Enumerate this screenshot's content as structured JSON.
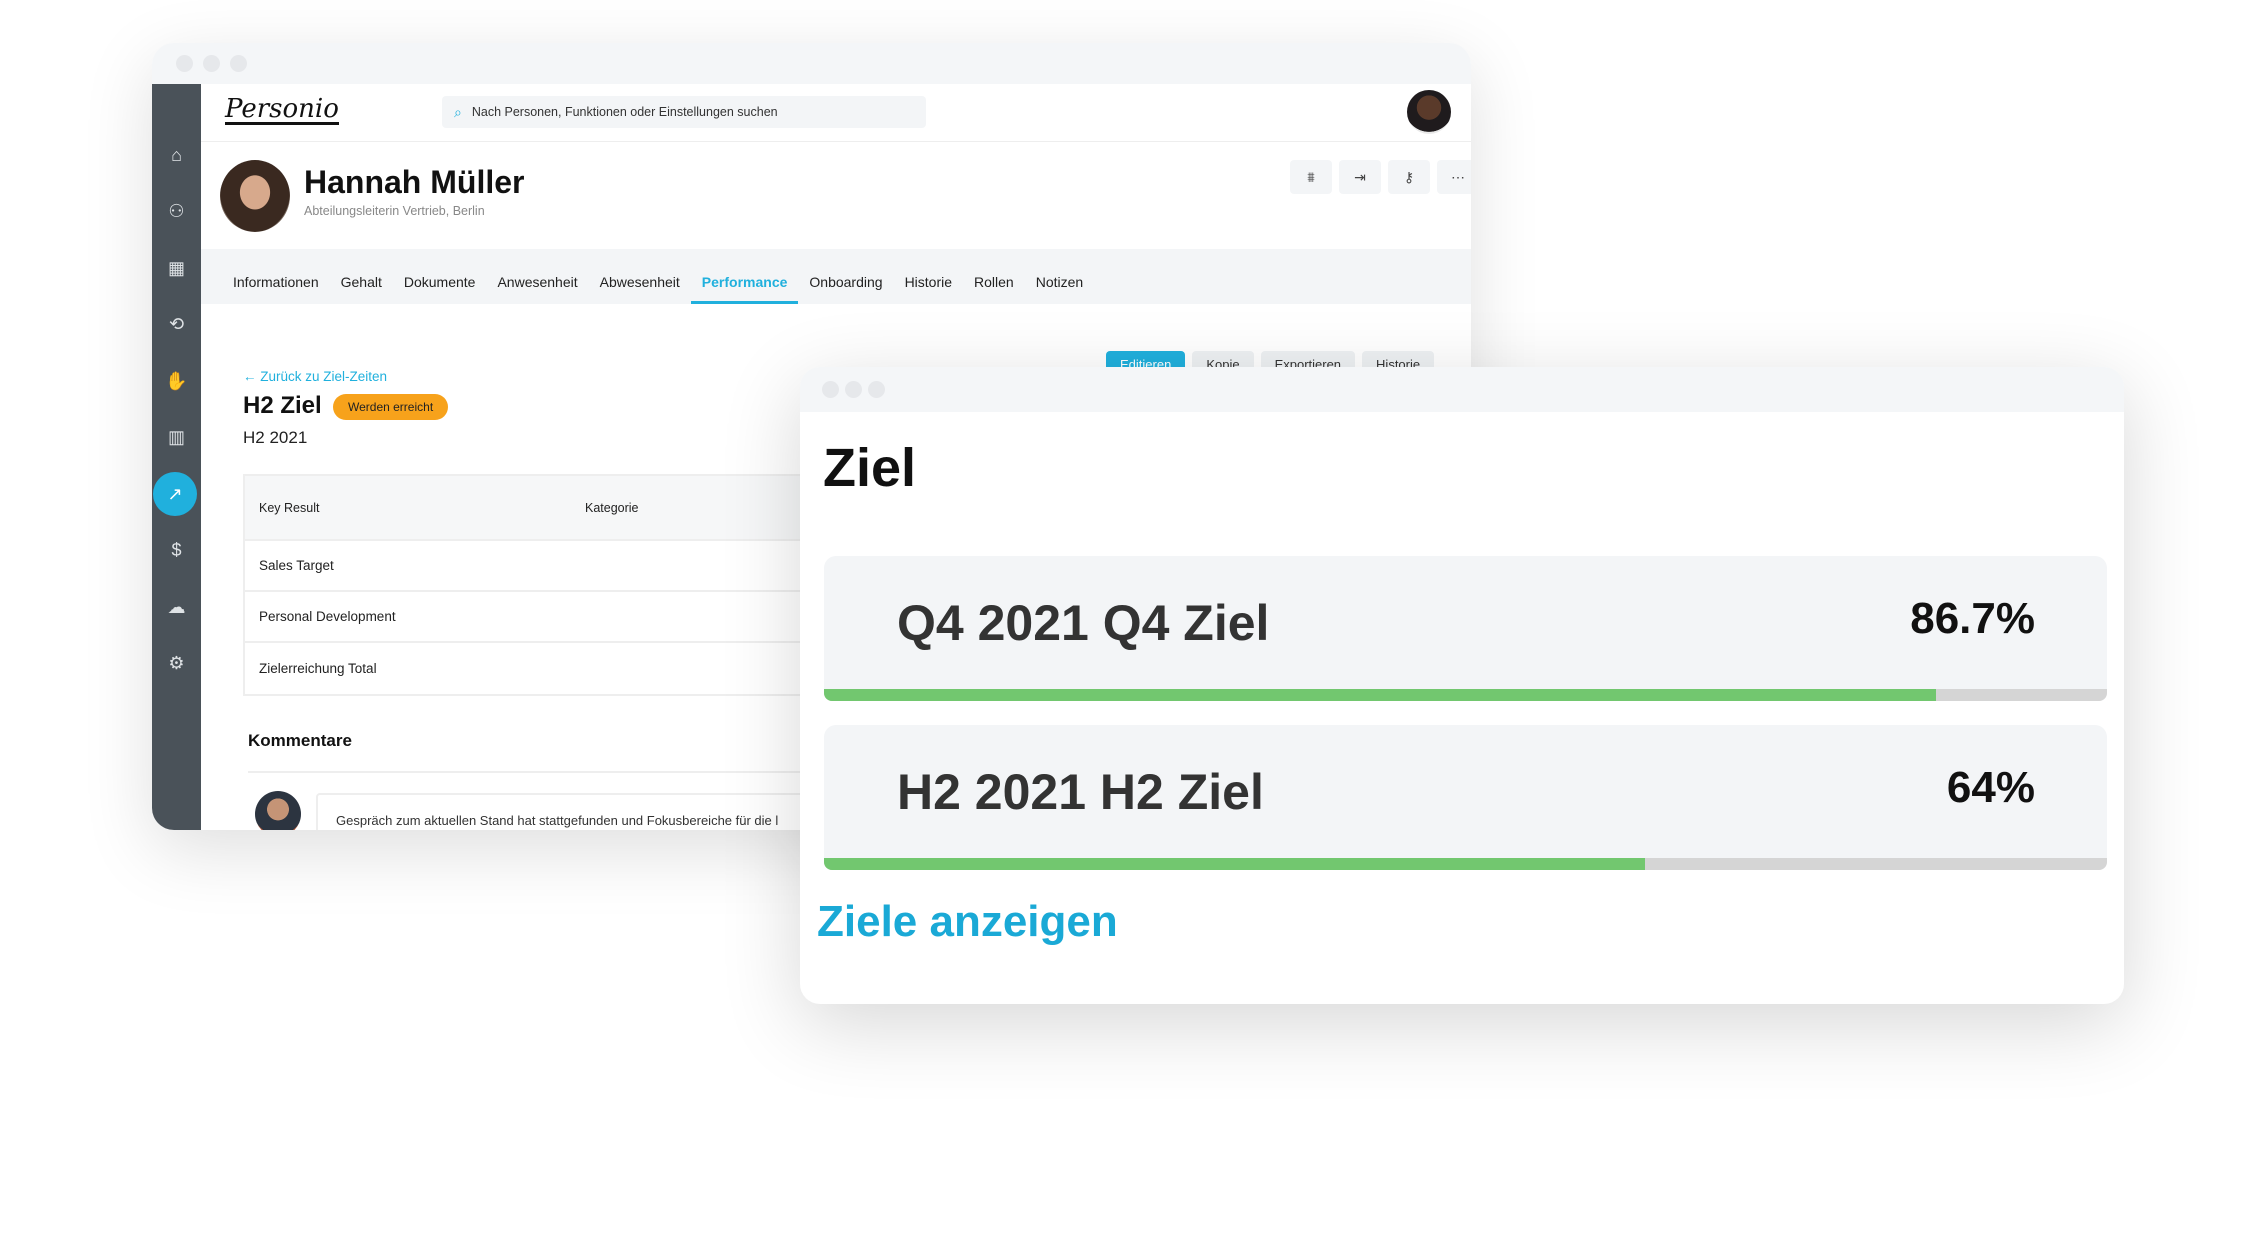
{
  "back_window": {
    "sidebar": {
      "icons": [
        "home-icon",
        "people-icon",
        "calendar-icon",
        "sync-icon",
        "handshake-icon",
        "bar-chart-icon",
        "performance-icon",
        "dollar-icon",
        "cloud-upload-icon",
        "gear-icon"
      ],
      "active": "performance-icon"
    },
    "header": {
      "logo": "Personio",
      "search_placeholder": "Nach Personen, Funktionen oder Einstellungen suchen"
    },
    "profile": {
      "name": "Hannah Müller",
      "subtitle": "Abteilungsleiterin Vertrieb, Berlin",
      "actions": [
        "org-chart-icon",
        "login-icon",
        "key-icon",
        "more-icon"
      ]
    },
    "tabs": [
      "Informationen",
      "Gehalt",
      "Dokumente",
      "Anwesenheit",
      "Abwesenheit",
      "Performance",
      "Onboarding",
      "Historie",
      "Rollen",
      "Notizen"
    ],
    "active_tab": "Performance",
    "top_buttons": [
      "Editieren",
      "Kopie",
      "Exportieren",
      "Historie"
    ],
    "back_link": "Zurück zu Ziel-Zeiten",
    "goal": {
      "title": "H2 Ziel",
      "status": "Werden erreicht",
      "period": "H2 2021"
    },
    "table": {
      "headers": [
        "Key Result",
        "Kategorie"
      ],
      "rows": [
        "Sales Target",
        "Personal Development",
        "Zielerreichung Total"
      ]
    },
    "comments": {
      "title": "Kommentare",
      "text": "Gespräch zum aktuellen Stand hat stattgefunden und Fokusbereiche für die l"
    }
  },
  "front_window": {
    "title": "Ziel",
    "goals": [
      {
        "label": "Q4 2021 Q4 Ziel",
        "percent_label": "86.7%",
        "progress": 86.7
      },
      {
        "label": "H2 2021 H2 Ziel",
        "percent_label": "64%",
        "progress": 64
      }
    ],
    "link": "Ziele anzeigen"
  },
  "colors": {
    "accent": "#20b0dd",
    "progress": "#72c76f",
    "badge": "#f7a21b",
    "sidebar": "#4a5259"
  }
}
